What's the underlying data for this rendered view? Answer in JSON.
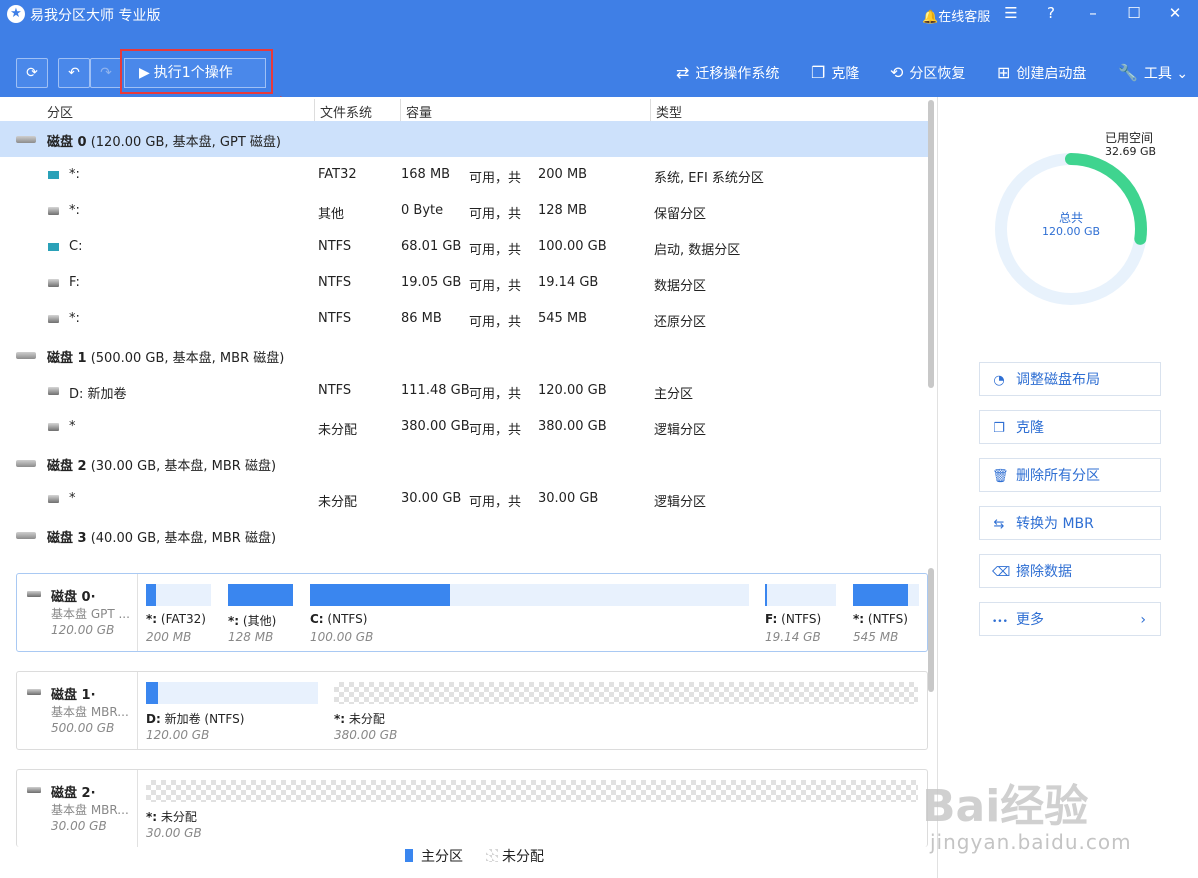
{
  "app": {
    "title": "易我分区大师 专业版",
    "online_service": "在线客服"
  },
  "toolbar": {
    "execute_label": "执行1个操作",
    "migrate_os": "迁移操作系统",
    "clone": "克隆",
    "partition_recovery": "分区恢复",
    "create_boot_disk": "创建启动盘",
    "tools": "工具"
  },
  "table": {
    "headers": [
      "分区",
      "文件系统",
      "容量",
      "类型"
    ],
    "rows": [
      {
        "kind": "disk",
        "name": "磁盘 0",
        "detail": "(120.00 GB, 基本盘, GPT 磁盘)",
        "selected": true
      },
      {
        "kind": "part",
        "icon": "win",
        "name": "*:",
        "fs": "FAT32",
        "free": "168 MB",
        "mid": "可用，共",
        "total": "200 MB",
        "type": "系统, EFI 系统分区"
      },
      {
        "kind": "part",
        "icon": "drv",
        "name": "*:",
        "fs": "其他",
        "free": "0 Byte",
        "mid": "可用，共",
        "total": "128 MB",
        "type": "保留分区"
      },
      {
        "kind": "part",
        "icon": "win",
        "name": "C:",
        "fs": "NTFS",
        "free": "68.01 GB",
        "mid": "可用，共",
        "total": "100.00 GB",
        "type": "启动, 数据分区"
      },
      {
        "kind": "part",
        "icon": "drv",
        "name": "F:",
        "fs": "NTFS",
        "free": "19.05 GB",
        "mid": "可用，共",
        "total": "19.14 GB",
        "type": "数据分区"
      },
      {
        "kind": "part",
        "icon": "drv",
        "name": "*:",
        "fs": "NTFS",
        "free": "86 MB",
        "mid": "可用，共",
        "total": "545 MB",
        "type": "还原分区"
      },
      {
        "kind": "disk",
        "name": "磁盘 1",
        "detail": "(500.00 GB, 基本盘, MBR 磁盘)",
        "selected": false
      },
      {
        "kind": "part",
        "icon": "drv",
        "name": "D: 新加卷",
        "fs": "NTFS",
        "free": "111.48 GB",
        "mid": "可用，共",
        "total": "120.00 GB",
        "type": "主分区"
      },
      {
        "kind": "part",
        "icon": "drv",
        "name": "*",
        "fs": "未分配",
        "free": "380.00 GB",
        "mid": "可用，共",
        "total": "380.00 GB",
        "type": "逻辑分区"
      },
      {
        "kind": "disk",
        "name": "磁盘 2",
        "detail": "(30.00 GB, 基本盘, MBR 磁盘)",
        "selected": false
      },
      {
        "kind": "part",
        "icon": "drv",
        "name": "*",
        "fs": "未分配",
        "free": "30.00 GB",
        "mid": "可用，共",
        "total": "30.00 GB",
        "type": "逻辑分区"
      },
      {
        "kind": "disk",
        "name": "磁盘 3",
        "detail": "(40.00 GB, 基本盘, MBR 磁盘)",
        "selected": false
      }
    ]
  },
  "disk_map": [
    {
      "name": "磁盘 0·",
      "type": "基本盘 GPT ...",
      "size": "120.00 GB",
      "active": true,
      "partitions": [
        {
          "label_b": "*:",
          "label": " (FAT32)",
          "size": "200 MB",
          "used_fraction": 0.16,
          "unalloc": false
        },
        {
          "label_b": "*:",
          "label": " (其他)",
          "size": "128 MB",
          "used_fraction": 1.0,
          "unalloc": false
        },
        {
          "label_b": "C:",
          "label": " (NTFS)",
          "size": "100.00 GB",
          "used_fraction": 0.32,
          "unalloc": false
        },
        {
          "label_b": "F:",
          "label": " (NTFS)",
          "size": "19.14 GB",
          "used_fraction": 0.005,
          "unalloc": false
        },
        {
          "label_b": "*:",
          "label": " (NTFS)",
          "size": "545 MB",
          "used_fraction": 0.84,
          "unalloc": false
        }
      ]
    },
    {
      "name": "磁盘 1·",
      "type": "基本盘 MBR...",
      "size": "500.00 GB",
      "active": false,
      "partitions": [
        {
          "label_b": "D:",
          "label": " 新加卷 (NTFS)",
          "size": "120.00 GB",
          "used_fraction": 0.07,
          "unalloc": false
        },
        {
          "label_b": "*:",
          "label": " 未分配",
          "size": "380.00 GB",
          "used_fraction": 0,
          "unalloc": true
        }
      ]
    },
    {
      "name": "磁盘 2·",
      "type": "基本盘 MBR...",
      "size": "30.00 GB",
      "active": false,
      "partitions": [
        {
          "label_b": "*:",
          "label": " 未分配",
          "size": "30.00 GB",
          "used_fraction": 0,
          "unalloc": true
        }
      ]
    }
  ],
  "summary": {
    "used_label": "已用空间",
    "used_value": "32.69 GB",
    "total_label": "总共",
    "total_value": "120.00 GB",
    "used_fraction": 0.2724,
    "ring_color": "#3fd48f",
    "ring_bg": "#e8f2fc"
  },
  "actions": [
    {
      "icon": "adjust-layout-icon",
      "glyph": "◔",
      "label": "调整磁盘布局"
    },
    {
      "icon": "clone-icon",
      "glyph": "❐",
      "label": "克隆"
    },
    {
      "icon": "trash-icon",
      "glyph": "🗑",
      "label": "删除所有分区"
    },
    {
      "icon": "convert-icon",
      "glyph": "⇆",
      "label": "转换为 MBR"
    },
    {
      "icon": "eraser-icon",
      "glyph": "⌫",
      "label": "擦除数据"
    },
    {
      "icon": "more-icon",
      "glyph": "•••",
      "label": "更多"
    }
  ],
  "legend": {
    "primary": "主分区",
    "unallocated": "未分配",
    "primary_color": "#3a86ef"
  },
  "watermark": {
    "brand": "Bai经验",
    "url": "jingyan.baidu.com"
  }
}
